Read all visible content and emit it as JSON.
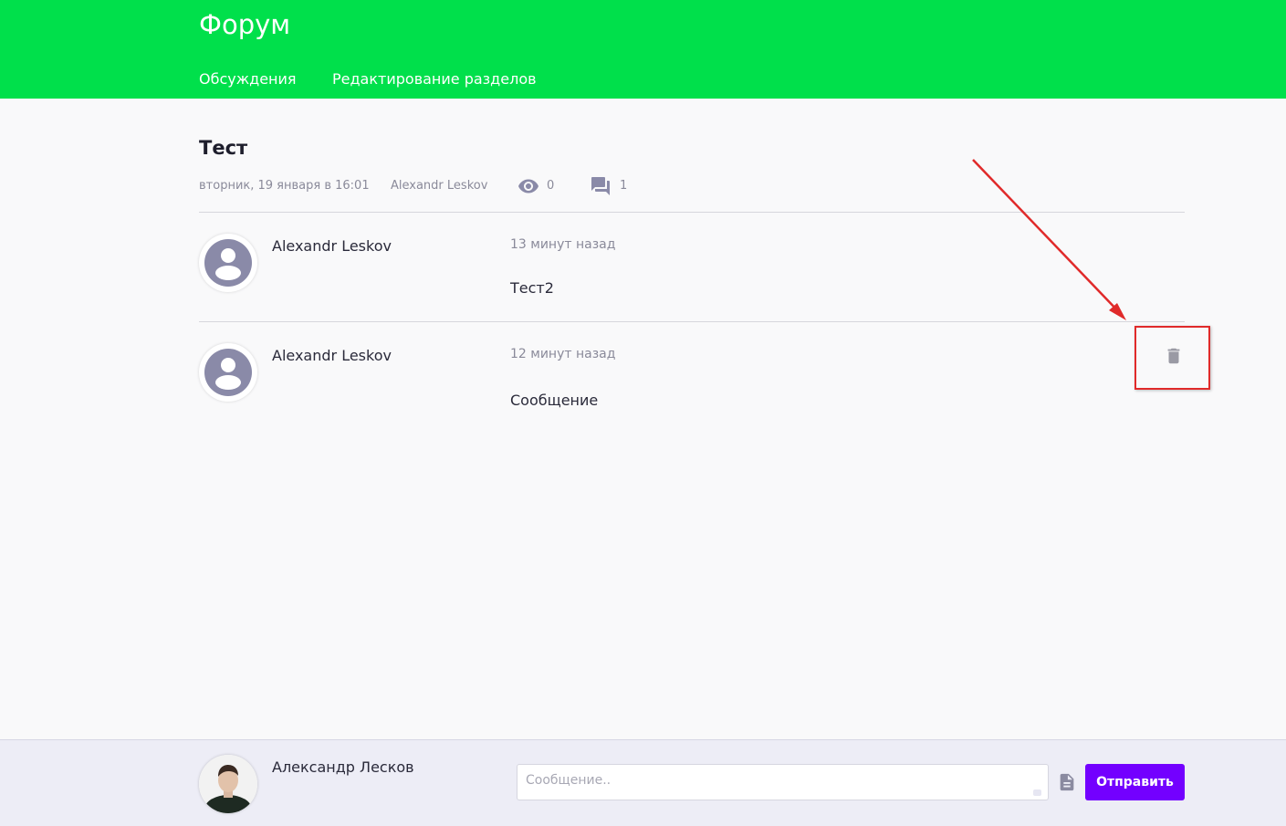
{
  "header": {
    "title": "Форум",
    "nav": [
      "Обсуждения",
      "Редактирование разделов"
    ]
  },
  "topic": {
    "title": "Тест",
    "date": "вторник, 19 января в 16:01",
    "author": "Alexandr Leskov",
    "views": "0",
    "comments": "1"
  },
  "posts": [
    {
      "author": "Alexandr Leskov",
      "time": "13 минут назад",
      "text": "Тест2"
    },
    {
      "author": "Alexandr Leskov",
      "time": "12 минут назад",
      "text": "Сообщение"
    }
  ],
  "composer": {
    "user": "Александр Лесков",
    "placeholder": "Сообщение..",
    "value": "",
    "send_label": "Отправить"
  },
  "icons": {
    "views": "eye-icon",
    "comments": "chat-icon",
    "delete": "trash-icon",
    "attach": "file-icon",
    "avatar": "user-avatar-icon"
  },
  "colors": {
    "header": "#00e04b",
    "accent": "#7300ff",
    "annotation": "#e02a2a",
    "icon": "#8a8aa8"
  }
}
